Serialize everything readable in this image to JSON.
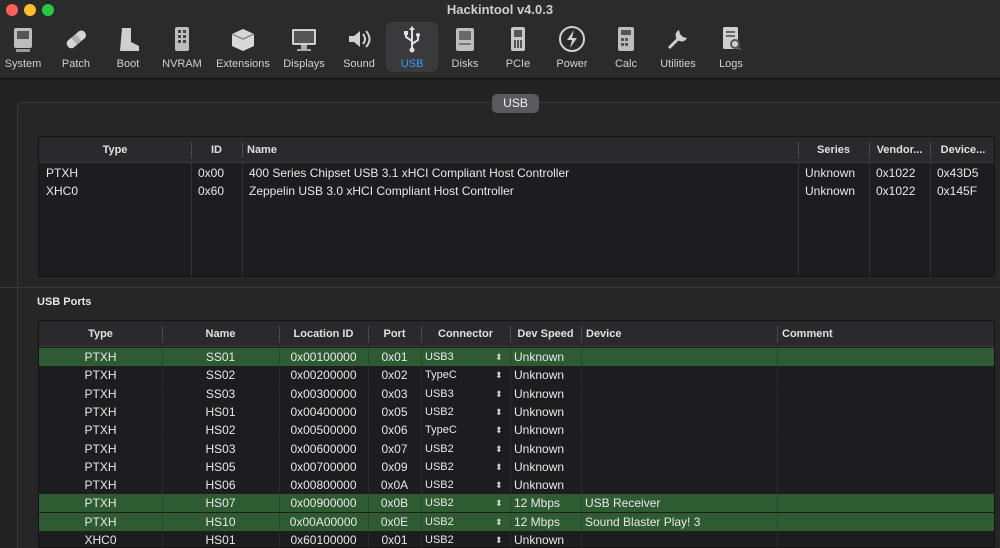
{
  "window": {
    "title": "Hackintool v4.0.3"
  },
  "toolbar": {
    "items": [
      {
        "label": "System",
        "icon": "system-icon"
      },
      {
        "label": "Patch",
        "icon": "patch-icon"
      },
      {
        "label": "Boot",
        "icon": "boot-icon"
      },
      {
        "label": "NVRAM",
        "icon": "nvram-icon"
      },
      {
        "label": "Extensions",
        "icon": "extensions-icon"
      },
      {
        "label": "Displays",
        "icon": "displays-icon"
      },
      {
        "label": "Sound",
        "icon": "sound-icon"
      },
      {
        "label": "USB",
        "icon": "usb-icon",
        "active": true
      },
      {
        "label": "Disks",
        "icon": "disks-icon"
      },
      {
        "label": "PCIe",
        "icon": "pcie-icon"
      },
      {
        "label": "Power",
        "icon": "power-icon"
      },
      {
        "label": "Calc",
        "icon": "calc-icon"
      },
      {
        "label": "Utilities",
        "icon": "utilities-icon"
      },
      {
        "label": "Logs",
        "icon": "logs-icon"
      }
    ]
  },
  "usb_group": {
    "label": "USB"
  },
  "controllers": {
    "headers": [
      "Type",
      "ID",
      "Name",
      "Series",
      "Vendor...",
      "Device..."
    ],
    "rows": [
      {
        "type": "PTXH",
        "id": "0x00",
        "name": "400 Series Chipset USB 3.1 xHCI Compliant Host Controller",
        "series": "Unknown",
        "vendor": "0x1022",
        "device": "0x43D5"
      },
      {
        "type": "XHC0",
        "id": "0x60",
        "name": "Zeppelin USB 3.0 xHCI Compliant Host Controller",
        "series": "Unknown",
        "vendor": "0x1022",
        "device": "0x145F"
      }
    ]
  },
  "usb_ports": {
    "title": "USB Ports",
    "headers": [
      "Type",
      "Name",
      "Location ID",
      "Port",
      "Connector",
      "Dev Speed",
      "Device",
      "Comment"
    ],
    "highlight_color": "#2f5b33",
    "rows": [
      {
        "type": "PTXH",
        "name": "SS01",
        "location": "0x00100000",
        "port": "0x01",
        "connector": "USB3",
        "speed": "Unknown",
        "device": "",
        "comment": "",
        "highlighted": true
      },
      {
        "type": "PTXH",
        "name": "SS02",
        "location": "0x00200000",
        "port": "0x02",
        "connector": "TypeC",
        "speed": "Unknown",
        "device": "",
        "comment": "",
        "highlighted": false
      },
      {
        "type": "PTXH",
        "name": "SS03",
        "location": "0x00300000",
        "port": "0x03",
        "connector": "USB3",
        "speed": "Unknown",
        "device": "",
        "comment": "",
        "highlighted": false
      },
      {
        "type": "PTXH",
        "name": "HS01",
        "location": "0x00400000",
        "port": "0x05",
        "connector": "USB2",
        "speed": "Unknown",
        "device": "",
        "comment": "",
        "highlighted": false
      },
      {
        "type": "PTXH",
        "name": "HS02",
        "location": "0x00500000",
        "port": "0x06",
        "connector": "TypeC",
        "speed": "Unknown",
        "device": "",
        "comment": "",
        "highlighted": false
      },
      {
        "type": "PTXH",
        "name": "HS03",
        "location": "0x00600000",
        "port": "0x07",
        "connector": "USB2",
        "speed": "Unknown",
        "device": "",
        "comment": "",
        "highlighted": false
      },
      {
        "type": "PTXH",
        "name": "HS05",
        "location": "0x00700000",
        "port": "0x09",
        "connector": "USB2",
        "speed": "Unknown",
        "device": "",
        "comment": "",
        "highlighted": false
      },
      {
        "type": "PTXH",
        "name": "HS06",
        "location": "0x00800000",
        "port": "0x0A",
        "connector": "USB2",
        "speed": "Unknown",
        "device": "",
        "comment": "",
        "highlighted": false
      },
      {
        "type": "PTXH",
        "name": "HS07",
        "location": "0x00900000",
        "port": "0x0B",
        "connector": "USB2",
        "speed": "12 Mbps",
        "device": "USB Receiver",
        "comment": "",
        "highlighted": true
      },
      {
        "type": "PTXH",
        "name": "HS10",
        "location": "0x00A00000",
        "port": "0x0E",
        "connector": "USB2",
        "speed": "12 Mbps",
        "device": "Sound Blaster Play! 3",
        "comment": "",
        "highlighted": true
      },
      {
        "type": "XHC0",
        "name": "HS01",
        "location": "0x60100000",
        "port": "0x01",
        "connector": "USB2",
        "speed": "Unknown",
        "device": "",
        "comment": "",
        "highlighted": false
      }
    ]
  }
}
